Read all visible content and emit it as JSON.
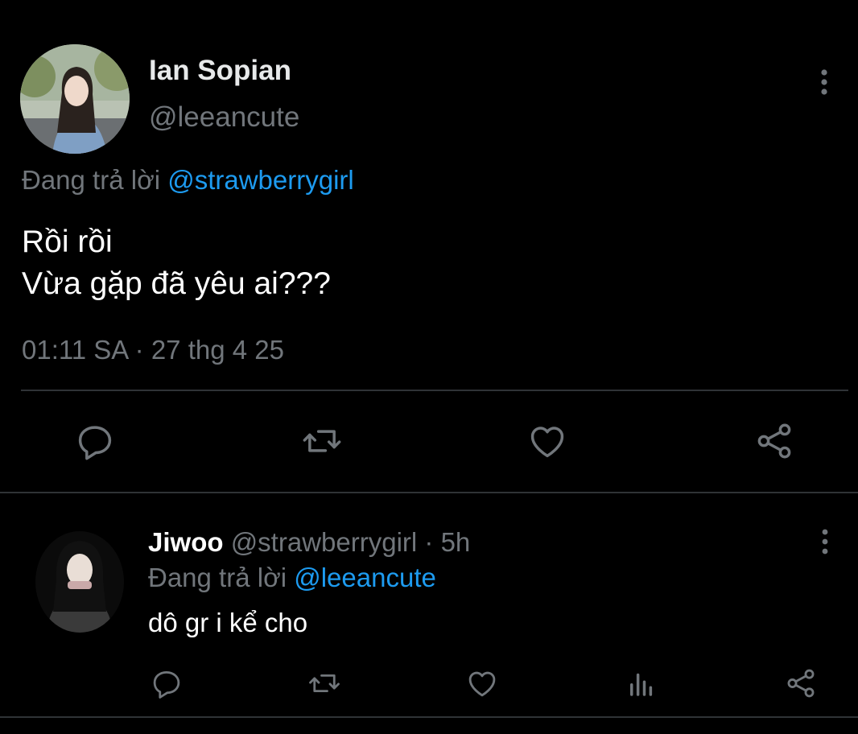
{
  "main_tweet": {
    "author_name": "Ian Sopian",
    "author_handle": "@leeancute",
    "replying_prefix": "Đang trả lời",
    "replying_to": "@strawberrygirl",
    "text_line1": "Rồi rồi",
    "text_line2": "Vừa gặp đã yêu ai???",
    "timestamp": "01:11 SA · 27 thg 4 25",
    "icons": [
      "avatar",
      "more-vertical-icon",
      "reply-icon",
      "retweet-icon",
      "like-icon",
      "share-icon"
    ]
  },
  "reply": {
    "author_name": "Jiwoo",
    "author_handle": "@strawberrygirl",
    "time": "· 5h",
    "replying_prefix": "Đang trả lời",
    "replying_to": "@leeancute",
    "text": "dô gr i kể cho",
    "icons": [
      "avatar",
      "more-vertical-icon",
      "reply-icon",
      "retweet-icon",
      "like-icon",
      "views-icon",
      "share-icon"
    ]
  },
  "colors": {
    "background": "#000000",
    "text": "#e7e9ea",
    "muted": "#71767b",
    "link": "#1d9bf0",
    "divider": "#2f3336"
  }
}
